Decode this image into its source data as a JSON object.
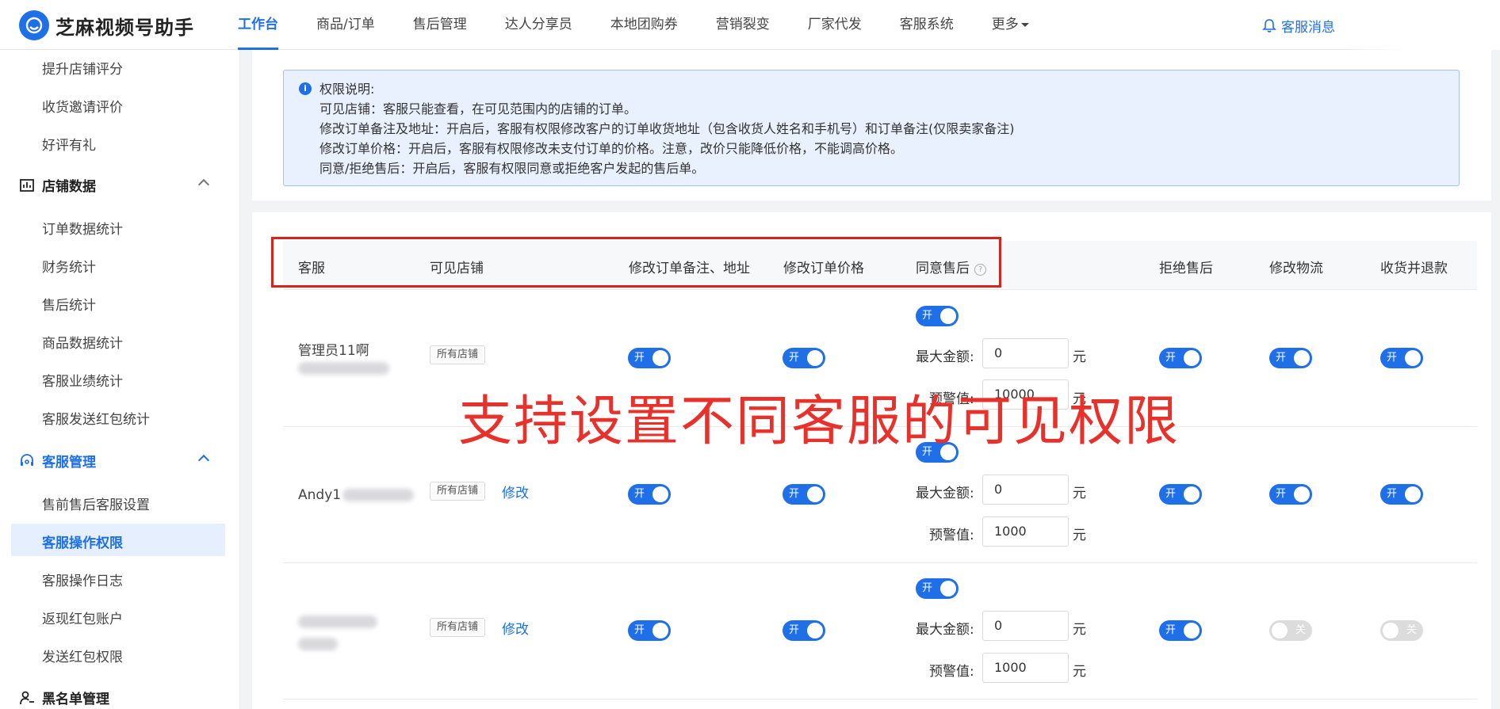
{
  "app": {
    "title": "芝麻视频号助手"
  },
  "nav": {
    "items": [
      "工作台",
      "商品/订单",
      "售后管理",
      "达人分享员",
      "本地团购券",
      "营销裂变",
      "厂家代发",
      "客服系统",
      "更多"
    ],
    "message": "客服消息"
  },
  "sidebar": {
    "top_items": [
      "提升店铺评分",
      "收货邀请评价",
      "好评有礼"
    ],
    "group_store": "店铺数据",
    "store_items": [
      "订单数据统计",
      "财务统计",
      "售后统计",
      "商品数据统计",
      "客服业绩统计",
      "客服发送红包统计"
    ],
    "group_service": "客服管理",
    "service_items": [
      "售前售后客服设置",
      "客服操作权限",
      "客服操作日志",
      "返现红包账户",
      "发送红包权限"
    ],
    "group_blacklist": "黑名单管理"
  },
  "notice": {
    "title": "权限说明:",
    "lines": [
      "可见店铺：客服只能查看，在可见范围内的店铺的订单。",
      "修改订单备注及地址：开启后，客服有权限修改客户的订单收货地址（包含收货人姓名和手机号）和订单备注(仅限卖家备注)",
      "修改订单价格：开启后，客服有权限修改未支付订单的价格。注意，改价只能降低价格，不能调高价格。",
      "同意/拒绝售后：开启后，客服有权限同意或拒绝客户发起的售后单。"
    ]
  },
  "table": {
    "headers": [
      "客服",
      "可见店铺",
      "修改订单备注、地址",
      "修改订单价格",
      "同意售后",
      "拒绝售后",
      "修改物流",
      "收货并退款"
    ],
    "max_label": "最大金额:",
    "warn_label": "预警值:",
    "unit": "元",
    "on_label": "开",
    "off_label": "关",
    "rows": [
      {
        "name": "管理员11啊",
        "shop": "所有店铺",
        "edit": "",
        "max": "0",
        "warn": "10000",
        "remark": "on",
        "price": "on",
        "agree": "on",
        "reject": "on",
        "logistics": "on",
        "refund": "on"
      },
      {
        "name": "Andy1",
        "shop": "所有店铺",
        "edit": "修改",
        "max": "0",
        "warn": "1000",
        "remark": "on",
        "price": "on",
        "agree": "on",
        "reject": "on",
        "logistics": "on",
        "refund": "on"
      },
      {
        "name": "",
        "shop": "所有店铺",
        "edit": "修改",
        "max": "0",
        "warn": "1000",
        "remark": "on",
        "price": "on",
        "agree": "on",
        "reject": "on",
        "logistics": "off",
        "refund": "off"
      }
    ]
  },
  "overlay": {
    "text": "支持设置不同客服的可见权限"
  },
  "colors": {
    "primary": "#1e6fe8",
    "annotation_red": "#e8312a",
    "notice_bg": "#e8f1fd"
  }
}
